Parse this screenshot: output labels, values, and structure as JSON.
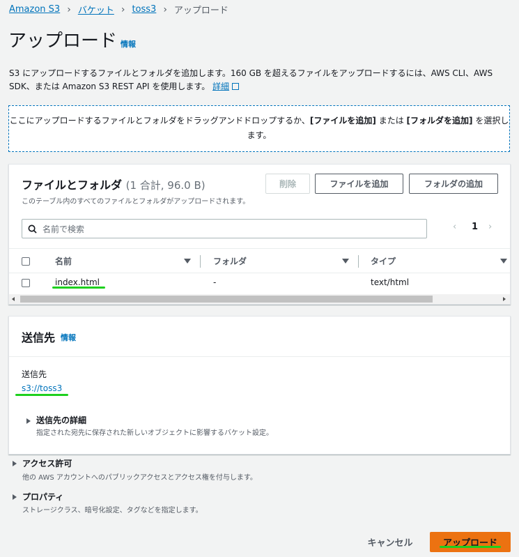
{
  "breadcrumb": {
    "items": [
      "Amazon S3",
      "バケット",
      "toss3"
    ],
    "current": "アップロード"
  },
  "page": {
    "title": "アップロード",
    "info_label": "情報",
    "description": "S3 にアップロードするファイルとフォルダを追加します。160 GB を超えるファイルをアップロードするには、AWS CLI、AWS SDK、または Amazon S3 REST API を使用します。",
    "details_link": "詳細"
  },
  "dropzone": {
    "text_before": "ここにアップロードするファイルとフォルダをドラッグアンドドロップするか、",
    "add_files": "[ファイルを追加]",
    "mid": " または ",
    "add_folder": "[フォルダを追加]",
    "text_after": " を選択します。"
  },
  "files_panel": {
    "title": "ファイルとフォルダ",
    "count": "(1 合計, 96.0 B)",
    "subtitle": "このテーブル内のすべてのファイルとフォルダがアップロードされます。",
    "remove_label": "削除",
    "add_files_label": "ファイルを追加",
    "add_folder_label": "フォルダの追加",
    "search_placeholder": "名前で検索",
    "page_number": "1",
    "columns": [
      "名前",
      "フォルダ",
      "タイプ"
    ],
    "rows": [
      {
        "name": "index.html",
        "folder": "-",
        "type": "text/html"
      }
    ]
  },
  "destination_panel": {
    "title": "送信先",
    "info_label": "情報",
    "field_label": "送信先",
    "value": "s3://toss3",
    "details_title": "送信先の詳細",
    "details_sub": "指定された宛先に保存された新しいオブジェクトに影響するバケット設定。"
  },
  "permissions": {
    "title": "アクセス許可",
    "sub": "他の AWS アカウントへのパブリックアクセスとアクセス権を付与します。"
  },
  "properties": {
    "title": "プロパティ",
    "sub": "ストレージクラス、暗号化設定、タグなどを指定します。"
  },
  "footer": {
    "cancel_label": "キャンセル",
    "upload_label": "アップロード"
  }
}
